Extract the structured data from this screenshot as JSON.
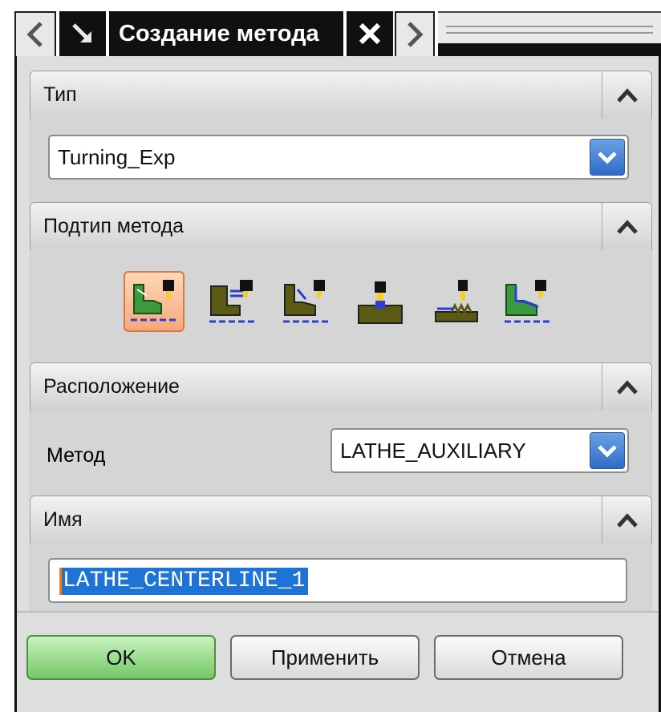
{
  "titlebar": {
    "title": "Создание метода",
    "prev_icon": "chevron-left-icon",
    "pin_icon": "pin-arrow-icon",
    "close_icon": "close-icon",
    "next_icon": "chevron-right-icon"
  },
  "sections": {
    "type": {
      "title": "Тип",
      "selected_value": "Turning_Exp"
    },
    "subtype": {
      "title": "Подтип метода",
      "icons": [
        {
          "name": "centerline-drilling-icon",
          "selected": true
        },
        {
          "name": "facing-icon",
          "selected": false
        },
        {
          "name": "rough-turning-icon",
          "selected": false
        },
        {
          "name": "grooving-icon",
          "selected": false
        },
        {
          "name": "threading-icon",
          "selected": false
        },
        {
          "name": "finish-turning-icon",
          "selected": false
        }
      ]
    },
    "location": {
      "title": "Расположение",
      "method_label": "Метод",
      "method_value": "LATHE_AUXILIARY"
    },
    "name": {
      "title": "Имя",
      "value": "LATHE_CENTERLINE_1"
    }
  },
  "buttons": {
    "ok": "OK",
    "apply": "Применить",
    "cancel": "Отмена"
  },
  "colors": {
    "ok_button": "#74c766",
    "selected_icon_bg": "#f6a97a",
    "selection_highlight": "#1e74d6",
    "dropdown_arrow": "#2f6cc6"
  }
}
